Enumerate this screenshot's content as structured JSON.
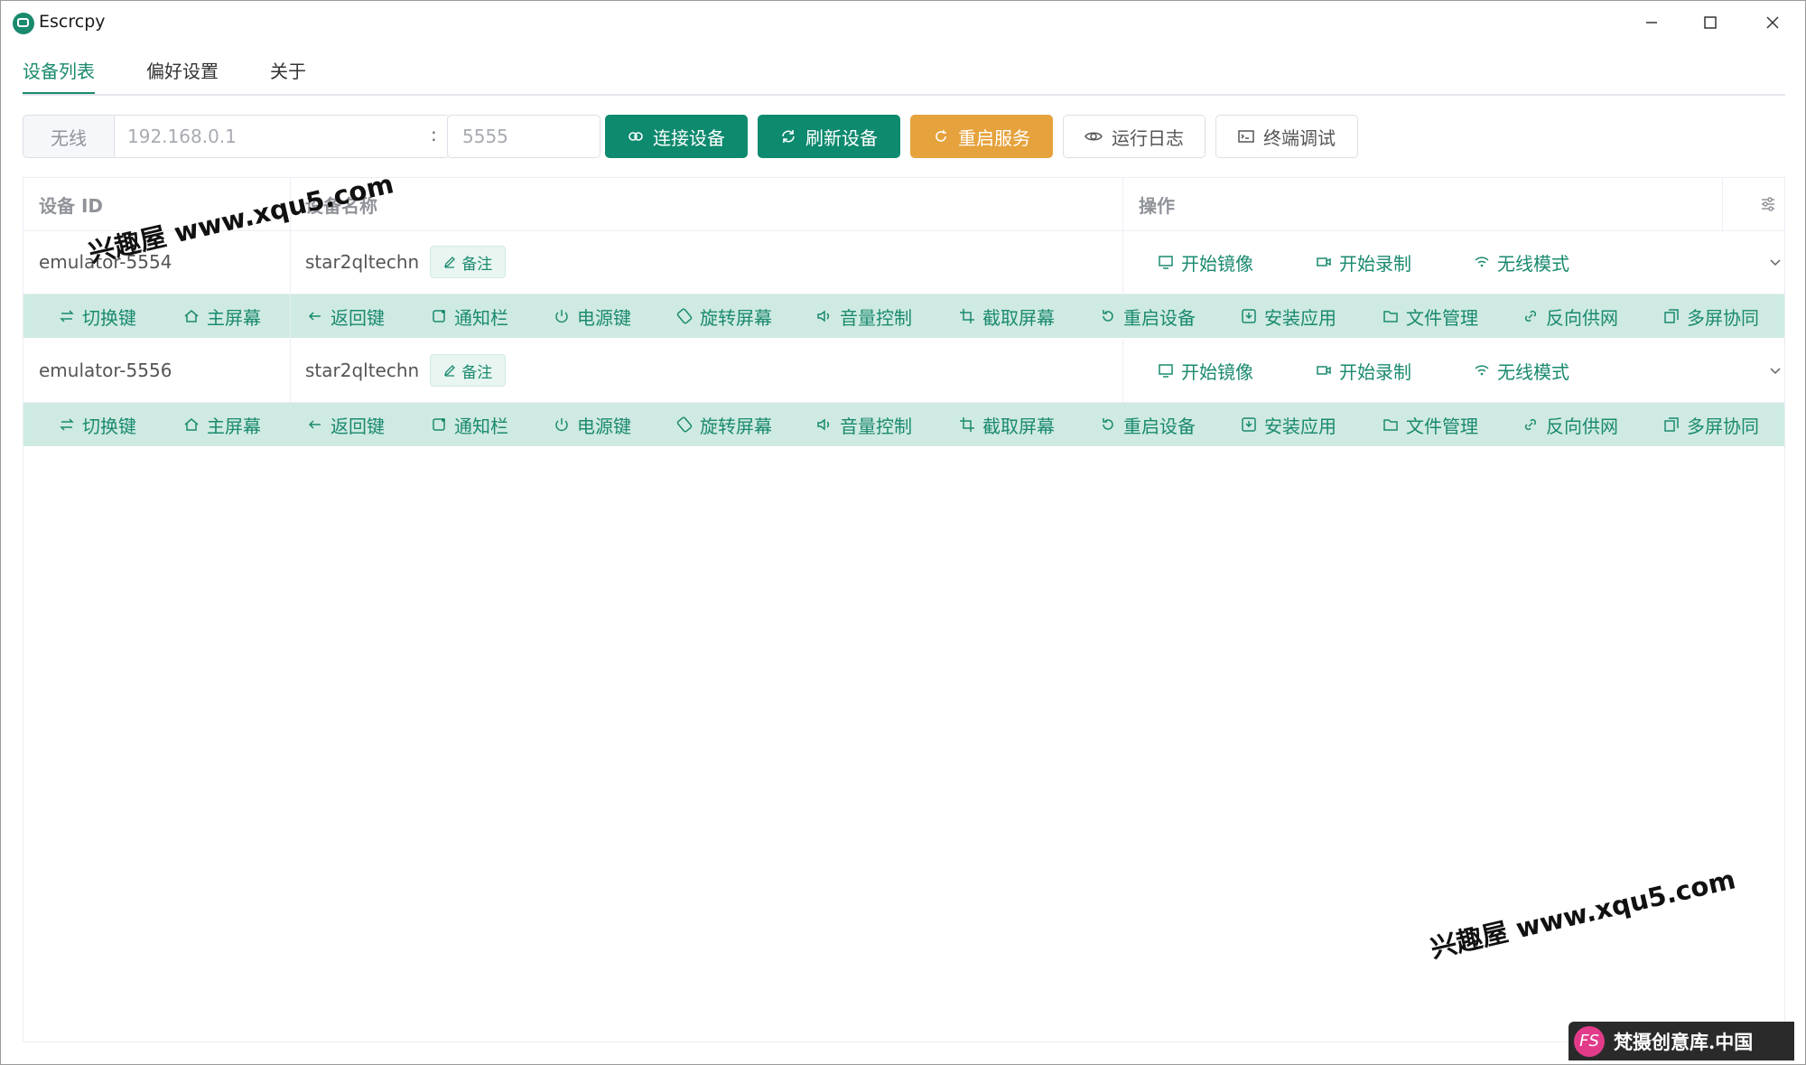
{
  "window": {
    "title": "Escrcpy"
  },
  "tabs": [
    {
      "label": "设备列表",
      "active": true
    },
    {
      "label": "偏好设置",
      "active": false
    },
    {
      "label": "关于",
      "active": false
    }
  ],
  "connect": {
    "prefix": "无线",
    "ip_placeholder": "192.168.0.1",
    "separator": ":",
    "port_placeholder": "5555",
    "buttons": {
      "connect": "连接设备",
      "refresh": "刷新设备",
      "restart": "重启服务",
      "log": "运行日志",
      "terminal": "终端调试"
    }
  },
  "table": {
    "headers": {
      "device_id": "设备 ID",
      "device_name": "设备名称",
      "actions": "操作"
    },
    "remark_label": "备注",
    "row_actions": [
      "开始镜像",
      "开始录制",
      "无线模式"
    ],
    "controls": [
      "切换键",
      "主屏幕",
      "返回键",
      "通知栏",
      "电源键",
      "旋转屏幕",
      "音量控制",
      "截取屏幕",
      "重启设备",
      "安装应用",
      "文件管理",
      "反向供网",
      "多屏协同"
    ],
    "rows": [
      {
        "id": "emulator-5554",
        "name": "star2qltechn"
      },
      {
        "id": "emulator-5556",
        "name": "star2qltechn"
      }
    ]
  },
  "watermarks": {
    "top": "兴趣屋 www.xqu5.com",
    "bottom": "兴趣屋 www.xqu5.com",
    "brand": "梵摄创意库.中国",
    "brand_logo": "FS"
  },
  "colors": {
    "primary": "#0e8a6e",
    "warning": "#e6a23c",
    "control_bar": "#cfeae2"
  }
}
